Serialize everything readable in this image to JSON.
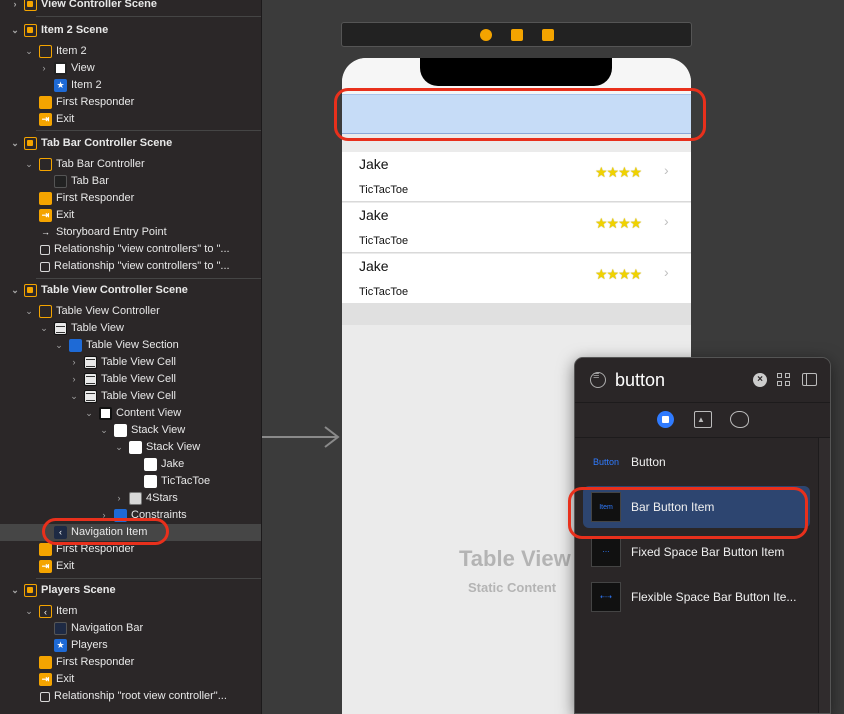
{
  "outline": {
    "rows": [
      {
        "label": "View Controller Scene",
        "scene": true
      },
      {
        "label": "Item 2 Scene",
        "scene": true
      },
      {
        "label": "Item 2"
      },
      {
        "label": "View"
      },
      {
        "label": "Item 2"
      },
      {
        "label": "First Responder"
      },
      {
        "label": "Exit"
      },
      {
        "label": "Tab Bar Controller Scene",
        "scene": true
      },
      {
        "label": "Tab Bar Controller"
      },
      {
        "label": "Tab Bar"
      },
      {
        "label": "First Responder"
      },
      {
        "label": "Exit"
      },
      {
        "label": "Storyboard Entry Point"
      },
      {
        "label": "Relationship \"view controllers\" to \"..."
      },
      {
        "label": "Relationship \"view controllers\" to \"..."
      },
      {
        "label": "Table View Controller Scene",
        "scene": true
      },
      {
        "label": "Table View Controller"
      },
      {
        "label": "Table View"
      },
      {
        "label": "Table View Section"
      },
      {
        "label": "Table View Cell"
      },
      {
        "label": "Table View Cell"
      },
      {
        "label": "Table View Cell"
      },
      {
        "label": "Content View"
      },
      {
        "label": "Stack View"
      },
      {
        "label": "Stack View"
      },
      {
        "label": "Jake"
      },
      {
        "label": "TicTacToe"
      },
      {
        "label": "4Stars"
      },
      {
        "label": "Constraints"
      },
      {
        "label": "Navigation Item"
      },
      {
        "label": "First Responder"
      },
      {
        "label": "Exit"
      },
      {
        "label": "Players Scene",
        "scene": true
      },
      {
        "label": "Item"
      },
      {
        "label": "Navigation Bar"
      },
      {
        "label": "Players"
      },
      {
        "label": "First Responder"
      },
      {
        "label": "Exit"
      },
      {
        "label": "Relationship \"root view controller\"..."
      }
    ]
  },
  "canvas": {
    "cells": [
      {
        "name": "Jake",
        "game": "TicTacToe",
        "stars": "★★★★"
      },
      {
        "name": "Jake",
        "game": "TicTacToe",
        "stars": "★★★★"
      },
      {
        "name": "Jake",
        "game": "TicTacToe",
        "stars": "★★★★"
      }
    ],
    "placeholder_title": "Table View",
    "placeholder_subtitle": "Static Content"
  },
  "library": {
    "search_value": "button",
    "items": [
      {
        "thumb": "Button",
        "name": "Button"
      },
      {
        "thumb": "Item",
        "name": "Bar Button Item"
      },
      {
        "thumb": "⋯",
        "name": "Fixed Space Bar Button Item"
      },
      {
        "thumb": "⇠⇢",
        "name": "Flexible Space Bar Button Ite..."
      }
    ]
  },
  "colors": {
    "accent": "#2f7bff",
    "highlight_ring": "#e8301c",
    "scene_icon": "#f4a400"
  }
}
